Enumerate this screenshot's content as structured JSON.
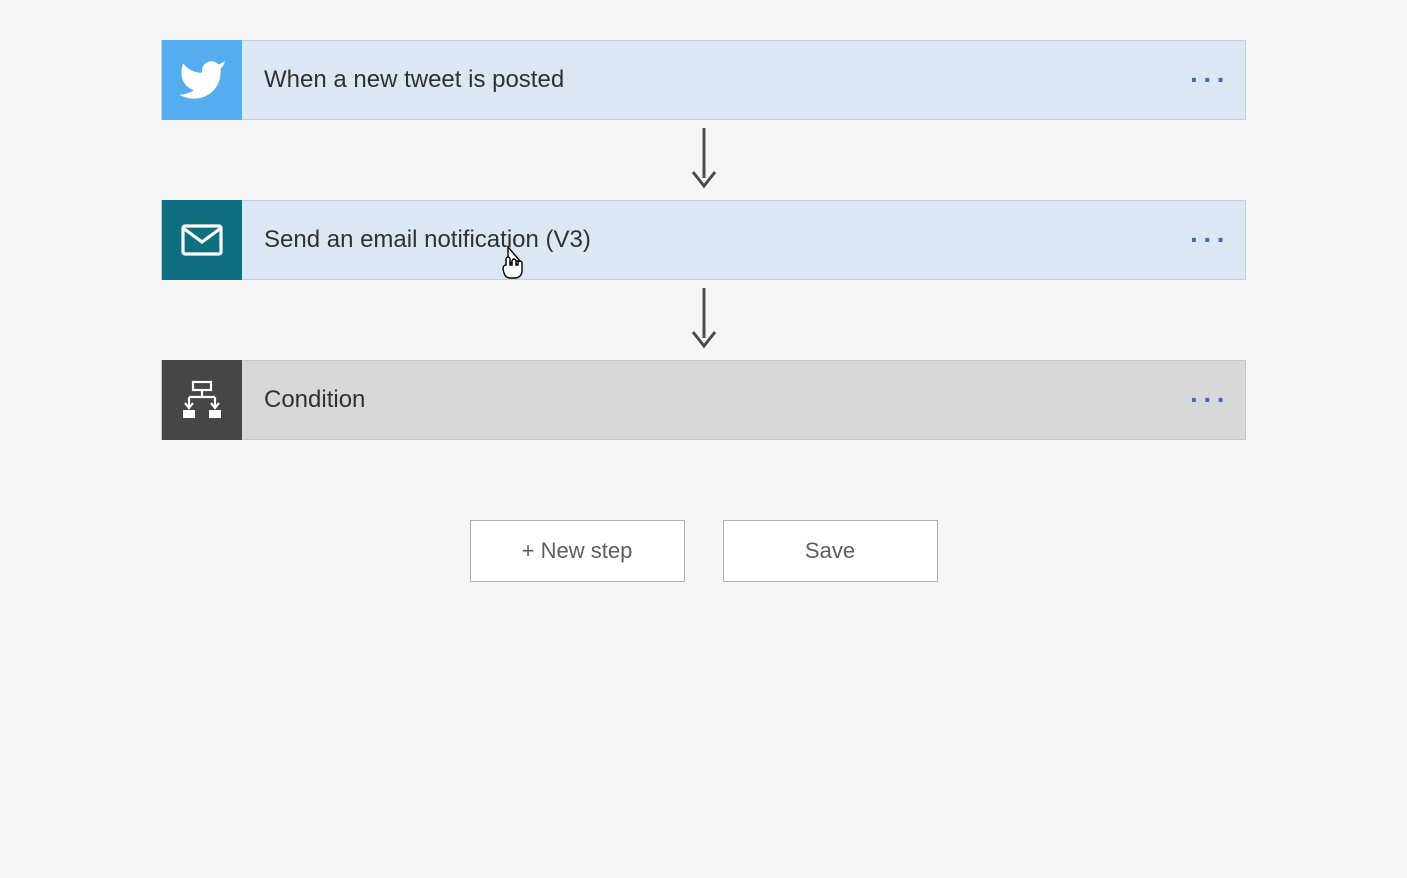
{
  "steps": [
    {
      "label": "When a new tweet is posted"
    },
    {
      "label": "Send an email notification (V3)"
    },
    {
      "label": "Condition"
    }
  ],
  "ellipsis_glyph": "···",
  "buttons": {
    "new_step": "+ New step",
    "save": "Save"
  }
}
